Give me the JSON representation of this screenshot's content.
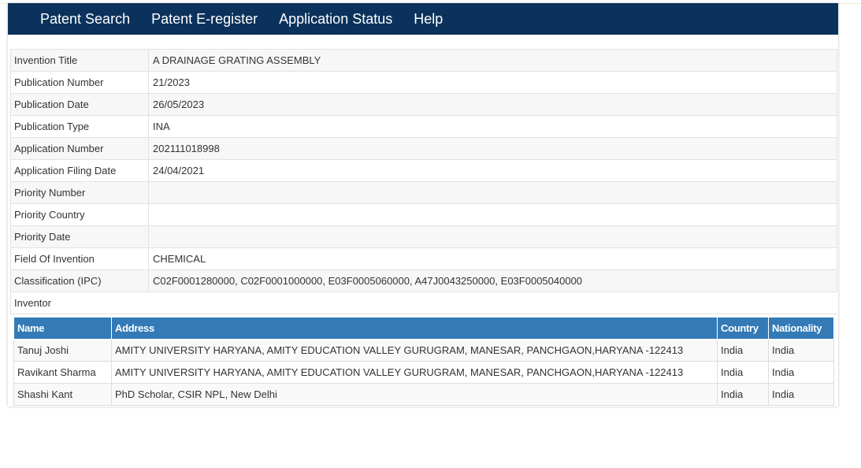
{
  "nav": {
    "items": [
      "Patent Search",
      "Patent E-register",
      "Application Status",
      "Help"
    ]
  },
  "details": [
    {
      "label": "Invention Title",
      "value": "A DRAINAGE GRATING ASSEMBLY"
    },
    {
      "label": "Publication Number",
      "value": "21/2023"
    },
    {
      "label": "Publication Date",
      "value": "26/05/2023"
    },
    {
      "label": "Publication Type",
      "value": "INA"
    },
    {
      "label": "Application Number",
      "value": "202111018998"
    },
    {
      "label": "Application Filing Date",
      "value": "24/04/2021"
    },
    {
      "label": "Priority Number",
      "value": ""
    },
    {
      "label": "Priority Country",
      "value": ""
    },
    {
      "label": "Priority Date",
      "value": ""
    },
    {
      "label": "Field Of Invention",
      "value": "CHEMICAL"
    },
    {
      "label": "Classification (IPC)",
      "value": "C02F0001280000, C02F0001000000, E03F0005060000, A47J0043250000, E03F0005040000"
    }
  ],
  "inventor": {
    "label": "Inventor",
    "headers": {
      "name": "Name",
      "address": "Address",
      "country": "Country",
      "nationality": "Nationality"
    },
    "rows": [
      {
        "name": "Tanuj Joshi",
        "address": "AMITY UNIVERSITY HARYANA, AMITY EDUCATION VALLEY GURUGRAM, MANESAR, PANCHGAON,HARYANA -122413",
        "country": "India",
        "nationality": "India"
      },
      {
        "name": "Ravikant Sharma",
        "address": "AMITY UNIVERSITY HARYANA, AMITY EDUCATION VALLEY GURUGRAM, MANESAR, PANCHGAON,HARYANA -122413",
        "country": "India",
        "nationality": "India"
      },
      {
        "name": "Shashi Kant",
        "address": "PhD Scholar, CSIR NPL, New Delhi",
        "country": "India",
        "nationality": "India"
      }
    ]
  },
  "colors": {
    "navbar": "#0b325c",
    "table_header": "#337ab7"
  }
}
